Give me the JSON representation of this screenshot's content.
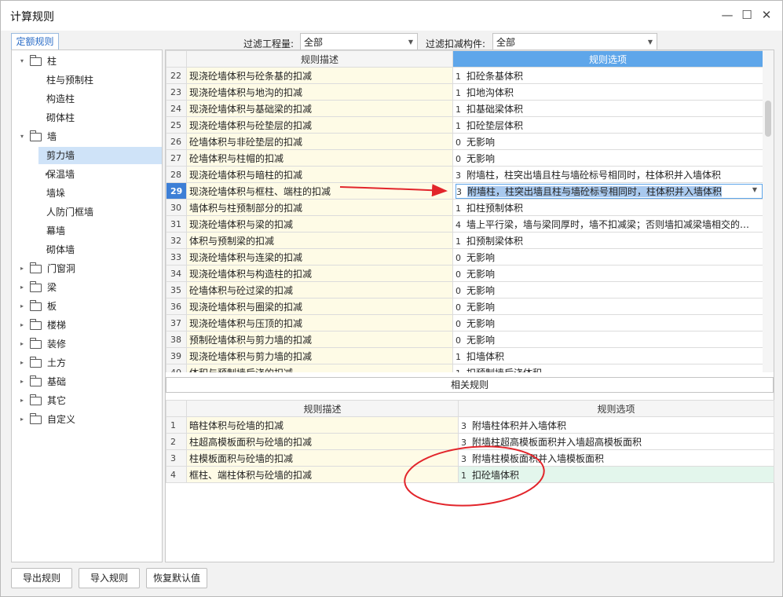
{
  "window": {
    "title": "计算规则"
  },
  "left_tab": "定额规则",
  "tree": [
    {
      "label": "柱",
      "level": 0,
      "arrow": "▾",
      "folder": true
    },
    {
      "label": "柱与预制柱",
      "level": 1
    },
    {
      "label": "构造柱",
      "level": 1
    },
    {
      "label": "砌体柱",
      "level": 1
    },
    {
      "label": "墙",
      "level": 0,
      "arrow": "▾",
      "folder": true
    },
    {
      "label": "剪力墙",
      "level": 1,
      "selected": true
    },
    {
      "label": "保温墙",
      "level": 1,
      "arrow": "▸"
    },
    {
      "label": "墙垛",
      "level": 1
    },
    {
      "label": "人防门框墙",
      "level": 1
    },
    {
      "label": "幕墙",
      "level": 1
    },
    {
      "label": "砌体墙",
      "level": 1
    },
    {
      "label": "门窗洞",
      "level": 0,
      "arrow": "▸",
      "folder": true
    },
    {
      "label": "梁",
      "level": 0,
      "arrow": "▸",
      "folder": true
    },
    {
      "label": "板",
      "level": 0,
      "arrow": "▸",
      "folder": true
    },
    {
      "label": "楼梯",
      "level": 0,
      "arrow": "▸",
      "folder": true
    },
    {
      "label": "装修",
      "level": 0,
      "arrow": "▸",
      "folder": true
    },
    {
      "label": "土方",
      "level": 0,
      "arrow": "▸",
      "folder": true
    },
    {
      "label": "基础",
      "level": 0,
      "arrow": "▸",
      "folder": true
    },
    {
      "label": "其它",
      "level": 0,
      "arrow": "▸",
      "folder": true
    },
    {
      "label": "自定义",
      "level": 0,
      "arrow": "▸",
      "folder": true
    }
  ],
  "filters": {
    "quantity_label": "过滤工程量:",
    "quantity_value": "全部",
    "component_label": "过滤扣减构件:",
    "component_value": "全部"
  },
  "top_table": {
    "headers": [
      "规则描述",
      "规则选项"
    ],
    "rows": [
      {
        "num": "22",
        "desc": "现浇砼墙体积与砼条基的扣减",
        "code": "1",
        "opt": "扣砼条基体积"
      },
      {
        "num": "23",
        "desc": "现浇砼墙体积与地沟的扣减",
        "code": "1",
        "opt": "扣地沟体积"
      },
      {
        "num": "24",
        "desc": "现浇砼墙体积与基础梁的扣减",
        "code": "1",
        "opt": "扣基础梁体积"
      },
      {
        "num": "25",
        "desc": "现浇砼墙体积与砼垫层的扣减",
        "code": "1",
        "opt": "扣砼垫层体积"
      },
      {
        "num": "26",
        "desc": "砼墙体积与非砼垫层的扣减",
        "code": "0",
        "opt": "无影响"
      },
      {
        "num": "27",
        "desc": "砼墙体积与柱帽的扣减",
        "code": "0",
        "opt": "无影响"
      },
      {
        "num": "28",
        "desc": "现浇砼墙体积与暗柱的扣减",
        "code": "3",
        "opt": "附墙柱，柱突出墙且柱与墙砼标号相同时，柱体积并入墙体积"
      },
      {
        "num": "29",
        "desc": "现浇砼墙体积与框柱、端柱的扣减",
        "code": "3",
        "opt": "附墙柱，柱突出墙且柱与墙砼标号相同时，柱体积并入墙体积",
        "selected": true
      },
      {
        "num": "30",
        "desc": "墙体积与柱预制部分的扣减",
        "code": "1",
        "opt": "扣柱预制体积"
      },
      {
        "num": "31",
        "desc": "现浇砼墙体积与梁的扣减",
        "code": "4",
        "opt": "墙上平行梁，墙与梁同厚时，墙不扣减梁；否则墙扣减梁墙相交的…"
      },
      {
        "num": "32",
        "desc": "体积与预制梁的扣减",
        "code": "1",
        "opt": "扣预制梁体积"
      },
      {
        "num": "33",
        "desc": "现浇砼墙体积与连梁的扣减",
        "code": "0",
        "opt": "无影响"
      },
      {
        "num": "34",
        "desc": "现浇砼墙体积与构造柱的扣减",
        "code": "0",
        "opt": "无影响"
      },
      {
        "num": "35",
        "desc": "砼墙体积与砼过梁的扣减",
        "code": "0",
        "opt": "无影响"
      },
      {
        "num": "36",
        "desc": "现浇砼墙体积与圈梁的扣减",
        "code": "0",
        "opt": "无影响"
      },
      {
        "num": "37",
        "desc": "现浇砼墙体积与压顶的扣减",
        "code": "0",
        "opt": "无影响"
      },
      {
        "num": "38",
        "desc": "预制砼墙体积与剪力墙的扣减",
        "code": "0",
        "opt": "无影响"
      },
      {
        "num": "39",
        "desc": "现浇砼墙体积与剪力墙的扣减",
        "code": "1",
        "opt": "扣墙体积"
      },
      {
        "num": "40",
        "desc": "体积与预制墙后浇的扣减",
        "code": "1",
        "opt": "扣预制墙后浇体积"
      }
    ]
  },
  "related_label": "相关规则",
  "bottom_table": {
    "headers": [
      "规则描述",
      "规则选项"
    ],
    "rows": [
      {
        "num": "1",
        "desc": "暗柱体积与砼墙的扣减",
        "code": "3",
        "opt": "附墙柱体积并入墙体积"
      },
      {
        "num": "2",
        "desc": "柱超高模板面积与砼墙的扣减",
        "code": "3",
        "opt": "附墙柱超高模板面积并入墙超高模板面积"
      },
      {
        "num": "3",
        "desc": "柱模板面积与砼墙的扣减",
        "code": "3",
        "opt": "附墙柱模板面积并入墙模板面积"
      },
      {
        "num": "4",
        "desc": "框柱、端柱体积与砼墙的扣减",
        "code": "1",
        "opt": "扣砼墙体积",
        "highlight": true
      }
    ]
  },
  "buttons": {
    "export": "导出规则",
    "import": "导入规则",
    "restore": "恢复默认值"
  },
  "colors": {
    "header_blue": "#5ea6ea",
    "selected_row_num": "#3d7fd6",
    "desc_bg": "#fefbe6",
    "annotation_red": "#e2252b",
    "bottom_highlight": "#e3f6ec"
  }
}
